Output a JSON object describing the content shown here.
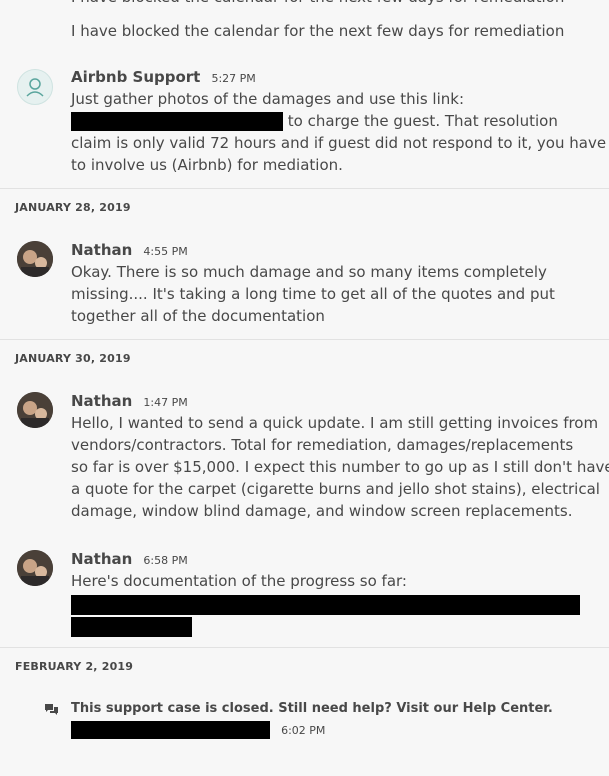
{
  "top": {
    "cut_line": "I have blocked the calendar for the next few days for remediation",
    "line": "I have blocked the calendar for the next few days for remediation"
  },
  "messages": [
    {
      "sender": "Airbnb Support",
      "time": "5:27 PM",
      "line1": "Just gather photos of the damages and use this link:",
      "line2_after_redaction": "to charge the guest. That resolution",
      "line3": "claim is only valid 72 hours and if guest did not respond to it, you have",
      "line4": "to involve us (Airbnb) for mediation."
    },
    {
      "sender": "Nathan",
      "time": "4:55 PM",
      "lines": [
        "Okay. There is so much damage and so many items completely",
        "missing.... It's taking a long time to get all of the quotes and put",
        "together all of the documentation"
      ]
    },
    {
      "sender": "Nathan",
      "time": "1:47 PM",
      "lines": [
        "Hello, I wanted to send a quick update. I am still getting invoices from",
        "vendors/contractors. Total for remediation, damages/replacements",
        "so far is over $15,000. I expect this number to go up as I still don't have",
        "a quote for the carpet (cigarette burns and jello shot stains), electrical",
        "damage, window blind damage, and window screen replacements."
      ]
    },
    {
      "sender": "Nathan",
      "time": "6:58 PM",
      "line1": "Here's documentation of the progress so far:"
    }
  ],
  "dates": {
    "d1": "JANUARY 28, 2019",
    "d2": "JANUARY 30, 2019",
    "d3": "FEBRUARY 2, 2019"
  },
  "closed": {
    "text": "This support case is closed. Still need help? Visit our Help Center.",
    "time": "6:02 PM"
  },
  "icons": {
    "support_avatar": "support-agent-icon",
    "closed": "chat-bubbles-icon"
  }
}
